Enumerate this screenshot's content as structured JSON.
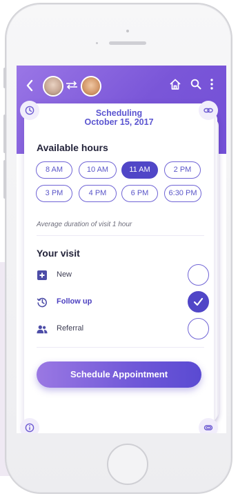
{
  "header": {
    "back_icon": "chevron-left-icon",
    "connect_icon": "swap-arrows-icon",
    "actions": [
      "home-icon",
      "search-icon",
      "more-vertical-icon"
    ]
  },
  "card": {
    "title_line1": "Scheduling",
    "title_line2": "October 15, 2017",
    "corner_icons": [
      "clock-icon",
      "link-icon",
      "info-icon",
      "paperclip-icon"
    ]
  },
  "hours": {
    "title": "Available hours",
    "slots": [
      "8 AM",
      "10 AM",
      "11 AM",
      "2 PM",
      "3 PM",
      "4 PM",
      "6 PM",
      "6:30 PM"
    ],
    "selected": "11 AM",
    "note": "Average duration of visit 1 hour"
  },
  "visit": {
    "title": "Your visit",
    "options": [
      {
        "label": "New",
        "icon": "plus-square-icon",
        "checked": false
      },
      {
        "label": "Follow up",
        "icon": "history-icon",
        "checked": true
      },
      {
        "label": "Referral",
        "icon": "users-icon",
        "checked": false
      }
    ]
  },
  "action": {
    "schedule_label": "Schedule Appointment"
  },
  "colors": {
    "accent": "#5046c7",
    "header_start": "#9a76e6",
    "header_end": "#7350d6",
    "button_start": "#9a78e3",
    "button_end": "#5a4ad2"
  }
}
